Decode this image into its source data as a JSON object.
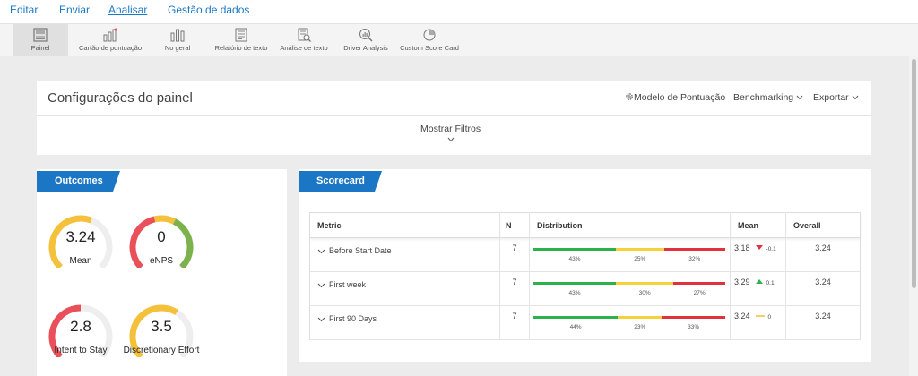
{
  "menu": [
    {
      "label": "Editar",
      "active": false
    },
    {
      "label": "Enviar",
      "active": false
    },
    {
      "label": "Analisar",
      "active": true
    },
    {
      "label": "Gestão de dados",
      "active": false
    }
  ],
  "toolbar": [
    {
      "label": "Painel",
      "icon": "dashboard-icon",
      "selected": true
    },
    {
      "label": "Cartão de pontuação",
      "icon": "scorecard-chart-icon",
      "selected": false
    },
    {
      "label": "No geral",
      "icon": "bar-chart-icon",
      "selected": false
    },
    {
      "label": "Relatório de texto",
      "icon": "text-report-icon",
      "selected": false
    },
    {
      "label": "Análise de texto",
      "icon": "text-analysis-icon",
      "selected": false
    },
    {
      "label": "Driver Analysis",
      "icon": "magnifier-chart-icon",
      "selected": false
    },
    {
      "label": "Custom Score Card",
      "icon": "pie-icon",
      "selected": false
    }
  ],
  "settings": {
    "title": "Configurações do painel",
    "scoring_model": "Modelo de Pontuação",
    "benchmarking": "Benchmarking",
    "export": "Exportar",
    "show_filters": "Mostrar Filtros"
  },
  "outcomes": {
    "tab": "Outcomes",
    "gauges": [
      {
        "value": "3.24",
        "label": "Mean",
        "fill": 0.58,
        "color": "#f5c13b"
      },
      {
        "value": "0",
        "label": "eNPS",
        "fill": 1.0,
        "color": "tri"
      },
      {
        "value": "2.8",
        "label": "Intent to Stay",
        "fill": 0.5,
        "color": "#e9505a"
      },
      {
        "value": "3.5",
        "label": "Discretionary Effort",
        "fill": 0.62,
        "color": "#f5c13b"
      }
    ]
  },
  "scorecard": {
    "tab": "Scorecard",
    "columns": {
      "metric": "Metric",
      "n": "N",
      "distribution": "Distribution",
      "mean": "Mean",
      "overall": "Overall"
    },
    "rows": [
      {
        "metric": "Before Start Date",
        "n": "7",
        "dist": [
          43,
          25,
          32
        ],
        "dist_labels": [
          "43%",
          "25%",
          "32%"
        ],
        "mean": "3.18",
        "delta": "-0.1",
        "trend": "down",
        "overall": "3.24"
      },
      {
        "metric": "First week",
        "n": "7",
        "dist": [
          43,
          30,
          27
        ],
        "dist_labels": [
          "43%",
          "30%",
          "27%"
        ],
        "mean": "3.29",
        "delta": "0.1",
        "trend": "up",
        "overall": "3.24"
      },
      {
        "metric": "First 90 Days",
        "n": "7",
        "dist": [
          44,
          23,
          33
        ],
        "dist_labels": [
          "44%",
          "23%",
          "33%"
        ],
        "mean": "3.24",
        "delta": "0",
        "trend": "flat",
        "overall": "3.24"
      }
    ],
    "colors": {
      "green": "#2bb24c",
      "yellow": "#f5d13b",
      "red": "#e0323c"
    }
  }
}
